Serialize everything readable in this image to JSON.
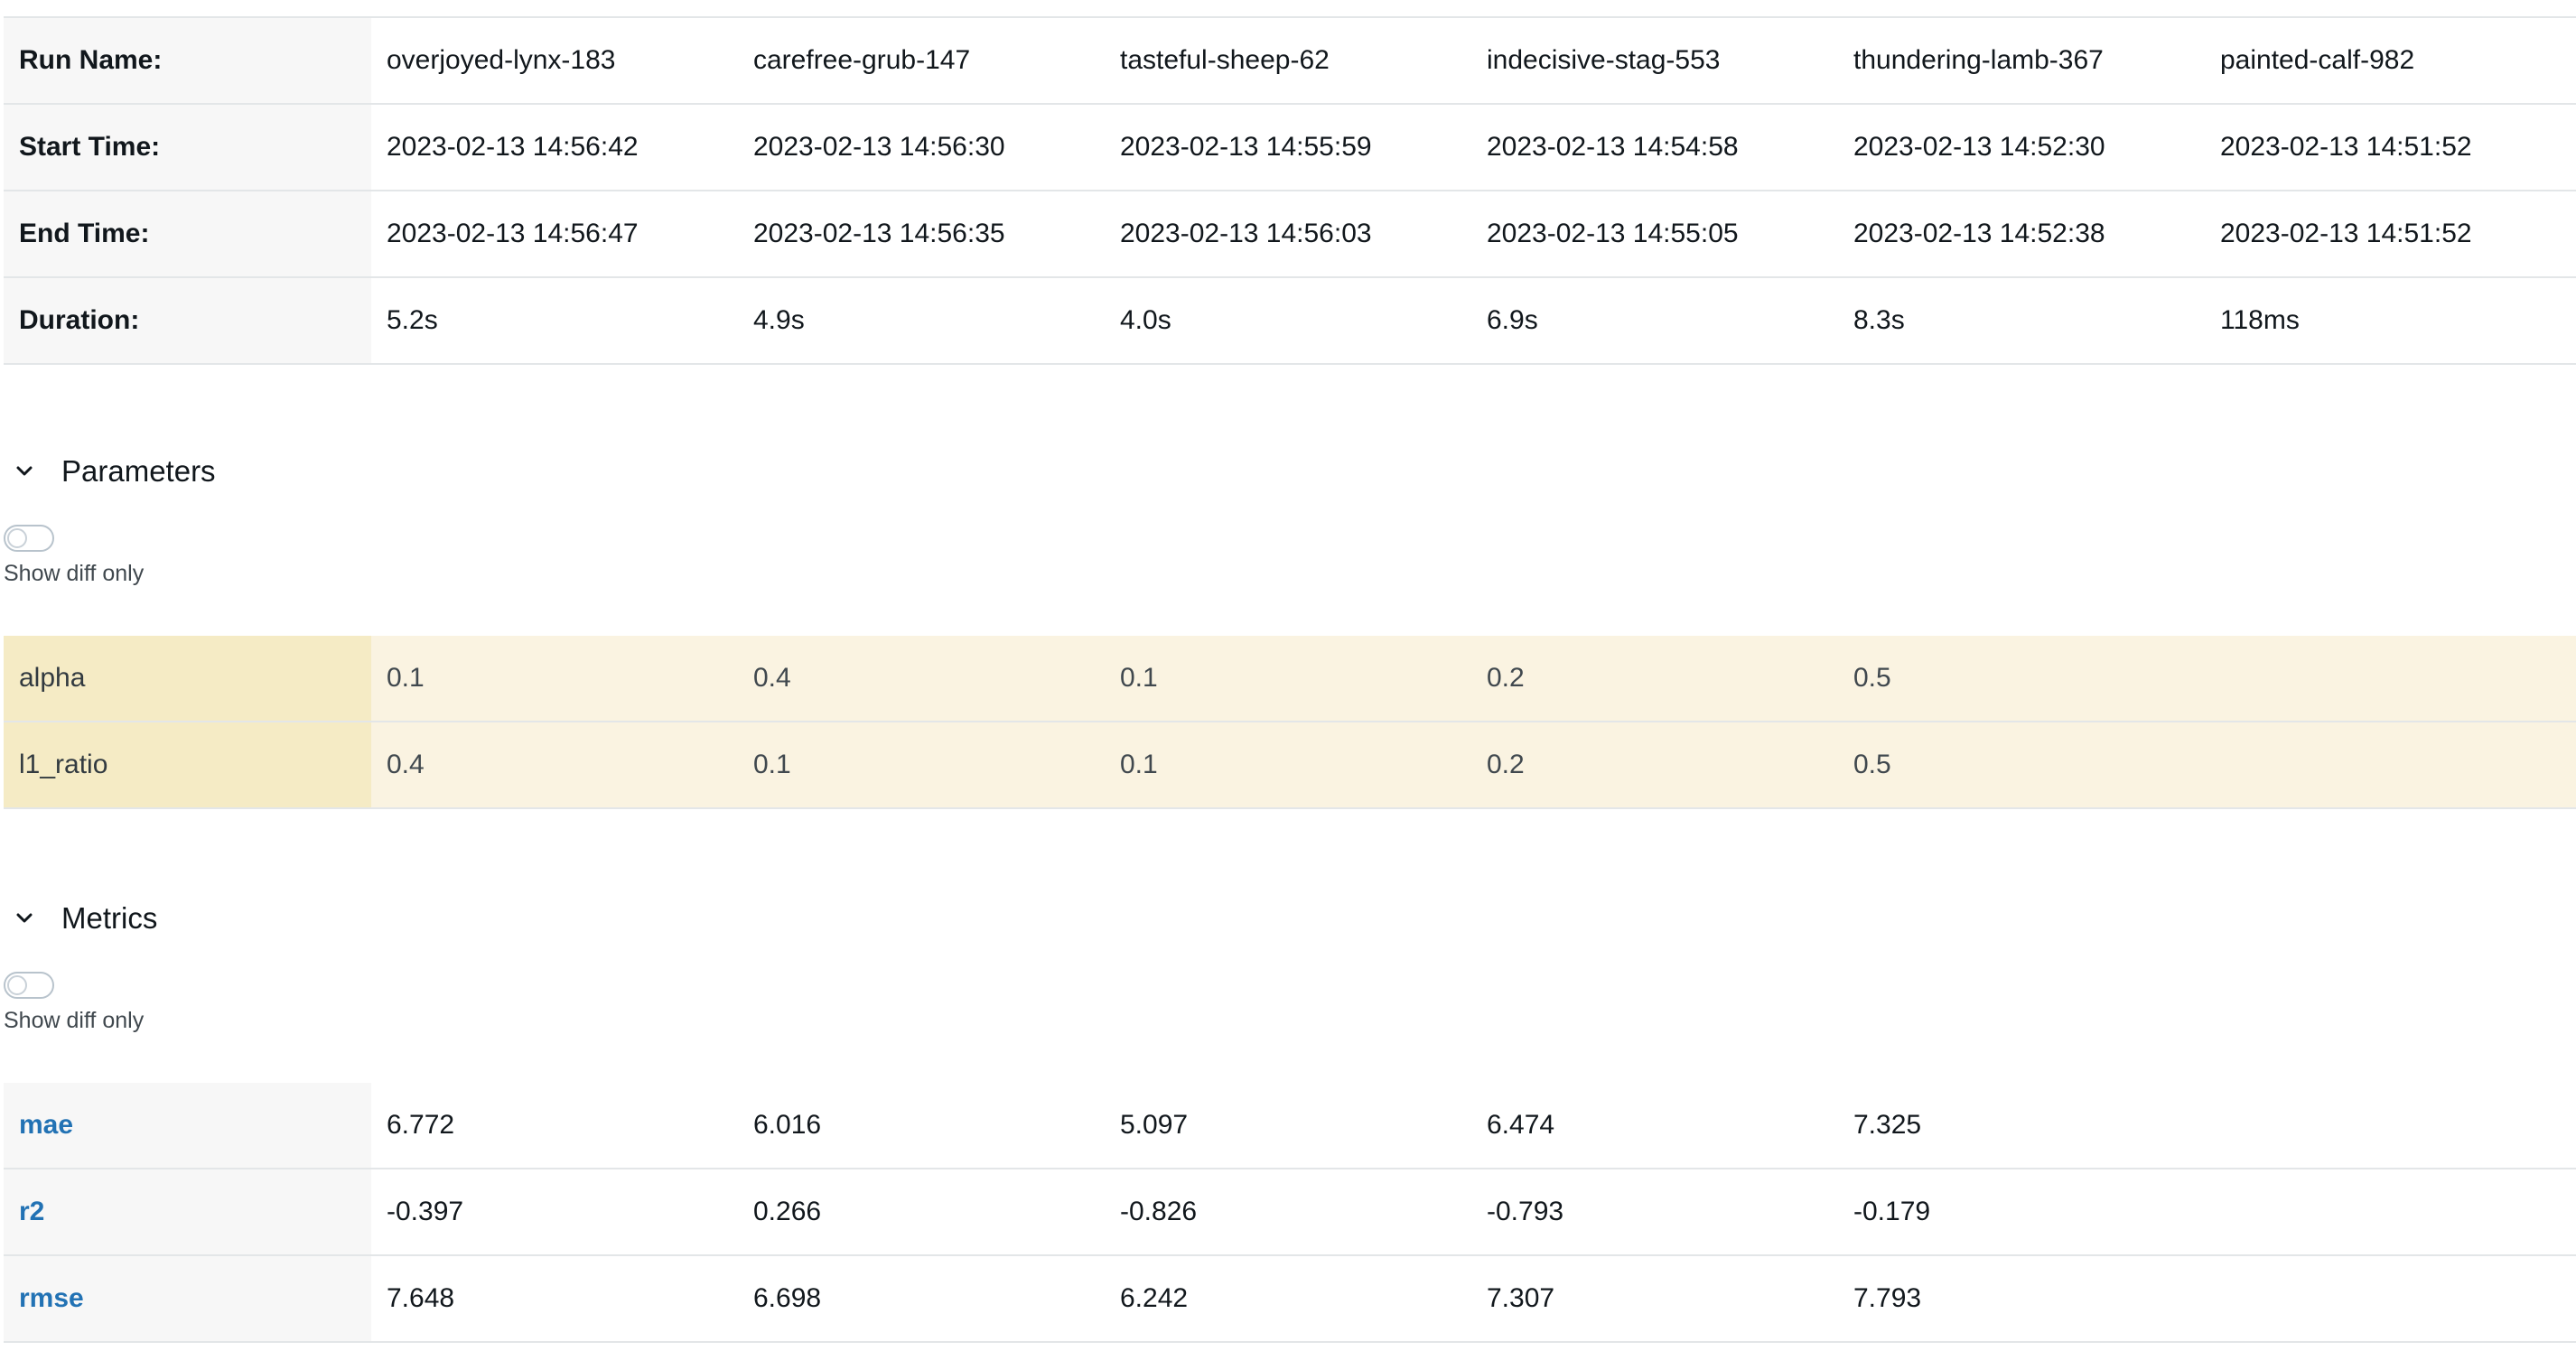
{
  "run_info": {
    "rows": [
      {
        "label": "Run Name:",
        "values": [
          "overjoyed-lynx-183",
          "carefree-grub-147",
          "tasteful-sheep-62",
          "indecisive-stag-553",
          "thundering-lamb-367",
          "painted-calf-982"
        ]
      },
      {
        "label": "Start Time:",
        "values": [
          "2023-02-13 14:56:42",
          "2023-02-13 14:56:30",
          "2023-02-13 14:55:59",
          "2023-02-13 14:54:58",
          "2023-02-13 14:52:30",
          "2023-02-13 14:51:52"
        ]
      },
      {
        "label": "End Time:",
        "values": [
          "2023-02-13 14:56:47",
          "2023-02-13 14:56:35",
          "2023-02-13 14:56:03",
          "2023-02-13 14:55:05",
          "2023-02-13 14:52:38",
          "2023-02-13 14:51:52"
        ]
      },
      {
        "label": "Duration:",
        "values": [
          "5.2s",
          "4.9s",
          "4.0s",
          "6.9s",
          "8.3s",
          "118ms"
        ]
      }
    ]
  },
  "parameters": {
    "title": "Parameters",
    "chevron_icon": "chevron-down-icon",
    "toggle_label": "Show diff only",
    "toggle_on": false,
    "highlight_color": "#faf3e1",
    "rows": [
      {
        "label": "alpha",
        "values": [
          "0.1",
          "0.4",
          "0.1",
          "0.2",
          "0.5",
          ""
        ]
      },
      {
        "label": "l1_ratio",
        "values": [
          "0.4",
          "0.1",
          "0.1",
          "0.2",
          "0.5",
          ""
        ]
      }
    ]
  },
  "metrics": {
    "title": "Metrics",
    "chevron_icon": "chevron-down-icon",
    "toggle_label": "Show diff only",
    "toggle_on": false,
    "link_color": "#2272b4",
    "rows": [
      {
        "label": "mae",
        "values": [
          "6.772",
          "6.016",
          "5.097",
          "6.474",
          "7.325",
          ""
        ]
      },
      {
        "label": "r2",
        "values": [
          "-0.397",
          "0.266",
          "-0.826",
          "-0.793",
          "-0.179",
          ""
        ]
      },
      {
        "label": "rmse",
        "values": [
          "7.648",
          "6.698",
          "6.242",
          "7.307",
          "7.793",
          ""
        ]
      }
    ]
  }
}
